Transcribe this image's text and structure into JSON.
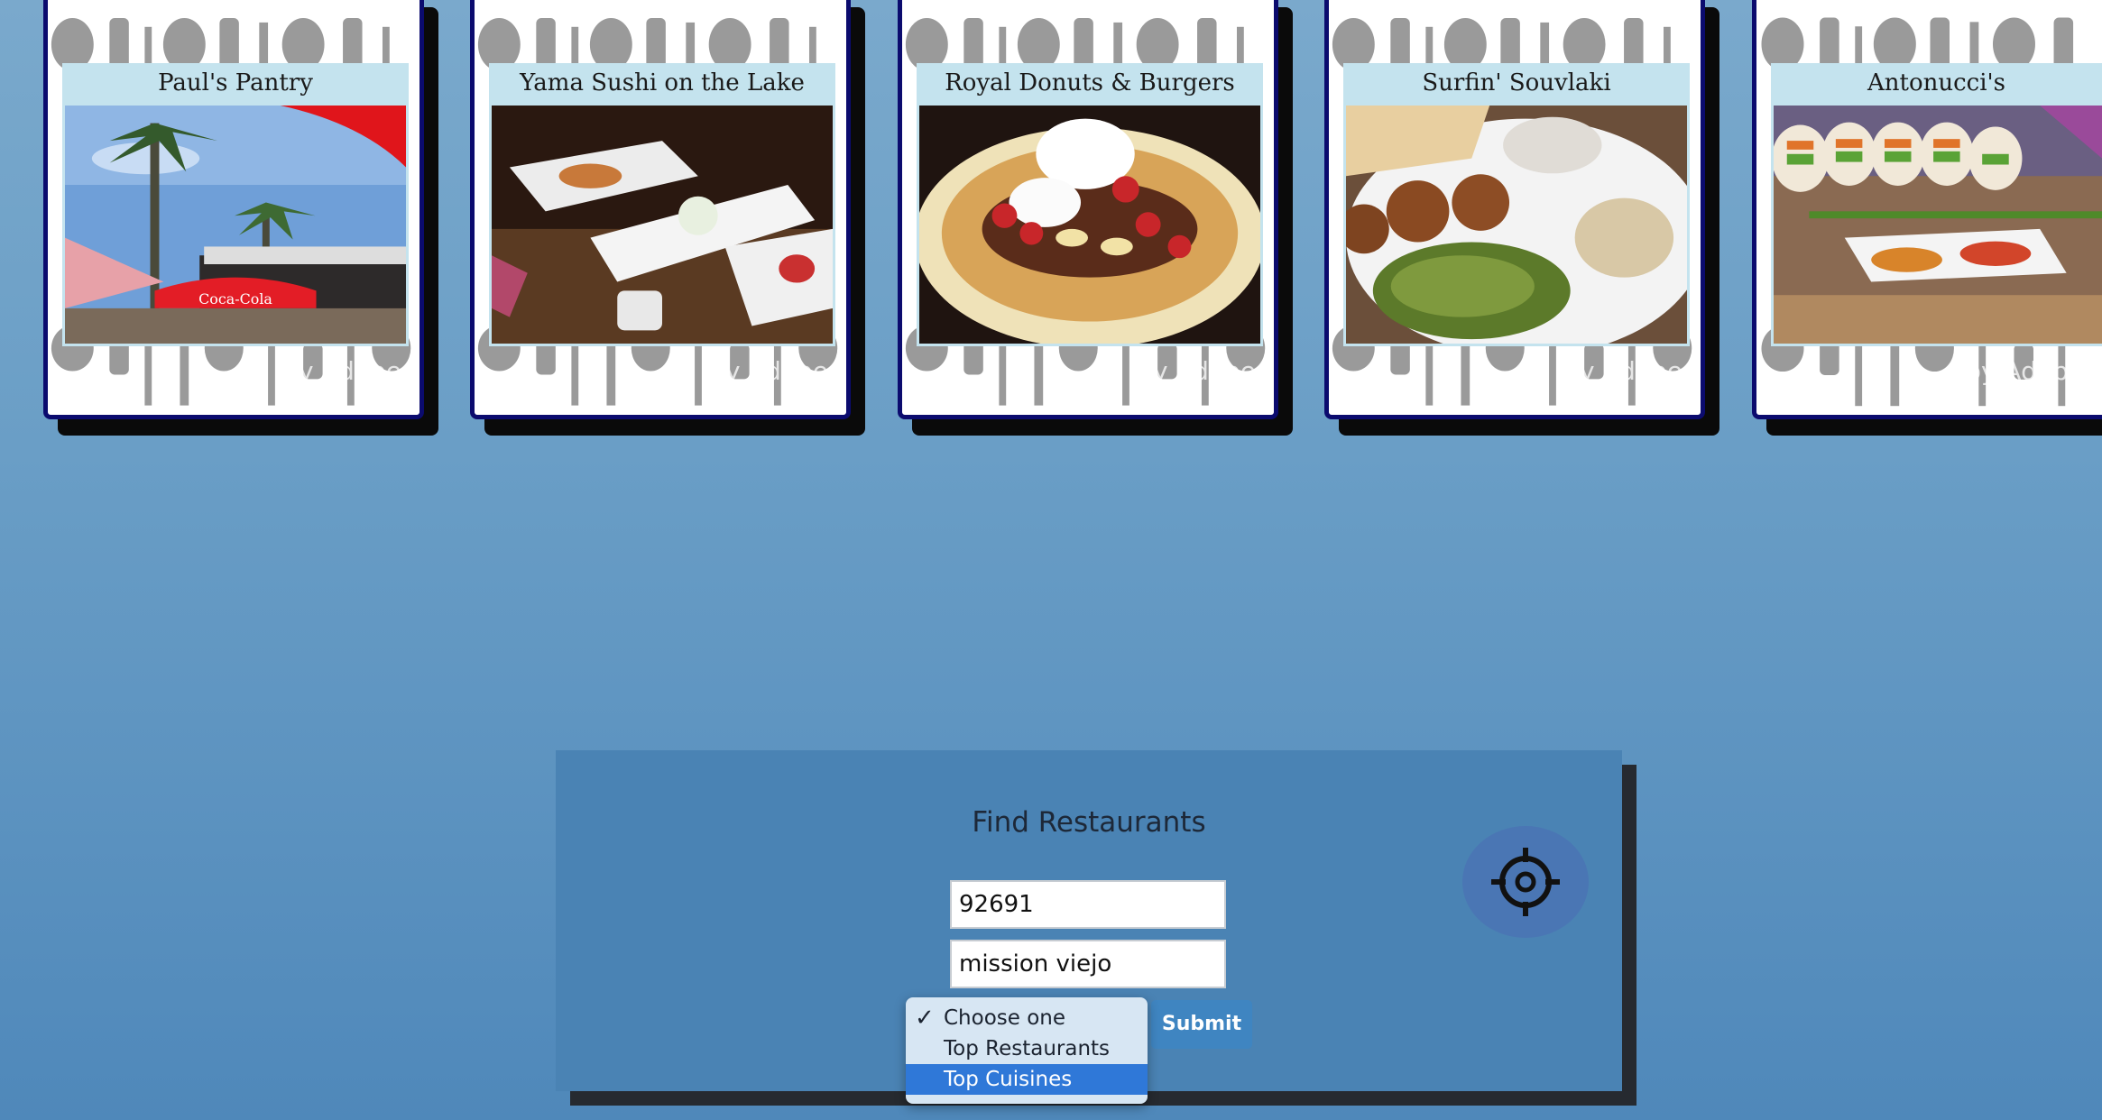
{
  "restaurants": [
    {
      "name": "Paul's Pantry",
      "photo": "patio-umbrellas-photo"
    },
    {
      "name": "Yama Sushi on the Lake",
      "photo": "sushi-plates-photo"
    },
    {
      "name": "Royal Donuts & Burgers",
      "photo": "waffle-photo"
    },
    {
      "name": "Surfin' Souvlaki",
      "photo": "falafel-plate-photo"
    },
    {
      "name": "Antonucci's",
      "photo": "spring-rolls-photo"
    }
  ],
  "watermark": "by Adobe",
  "search": {
    "title": "Find Restaurants",
    "zip_value": "92691",
    "city_value": "mission viejo",
    "submit_label": "Submit",
    "options": [
      "Choose one",
      "Top Restaurants",
      "Top Cuisines"
    ],
    "checked_option": "Choose one",
    "highlighted_option": "Top Cuisines"
  },
  "colors": {
    "card_border": "#0b0b6e",
    "title_band": "#c4e3ee",
    "panel": "#4a83b4",
    "submit": "#3f85c1",
    "highlight": "#2f78d8"
  }
}
